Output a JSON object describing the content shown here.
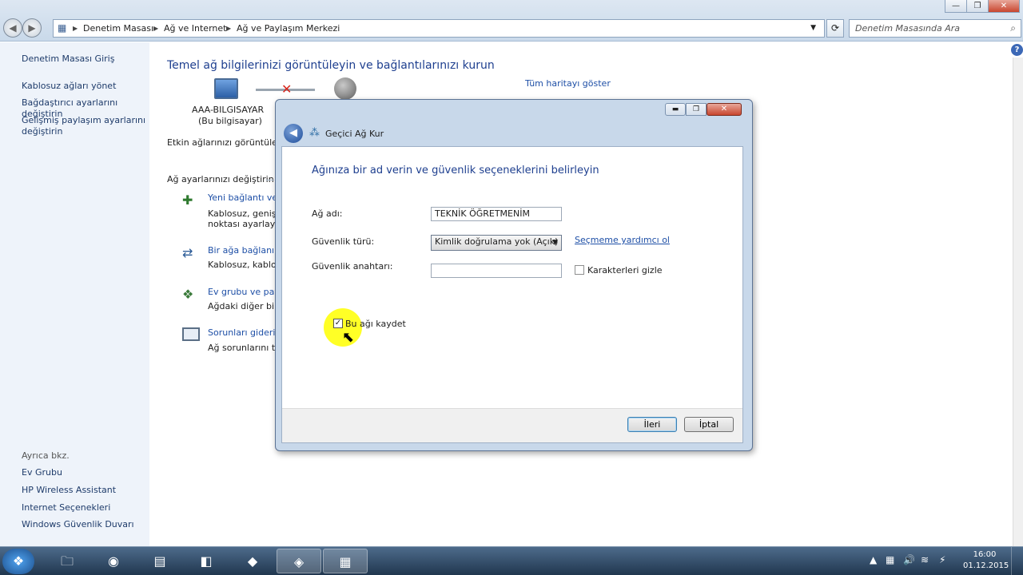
{
  "window_controls": {
    "minimize": "—",
    "maximize": "❐",
    "close": "✕"
  },
  "breadcrumb": [
    "Denetim Masası",
    "Ağ ve Internet",
    "Ağ ve Paylaşım Merkezi"
  ],
  "search": {
    "placeholder": "Denetim Masasında Ara"
  },
  "sidebar": {
    "home": "Denetim Masası Giriş",
    "items": [
      "Kablosuz ağları yönet",
      "Bağdaştırıcı ayarlarını değiştirin",
      "Gelişmiş paylaşım ayarlarını",
      "değiştirin"
    ],
    "see_also_title": "Ayrıca bkz.",
    "see_also": [
      "Ev Grubu",
      "HP Wireless Assistant",
      "Internet Seçenekleri",
      "Windows Güvenlik Duvarı"
    ]
  },
  "main": {
    "title": "Temel ağ bilgilerinizi görüntüleyin ve bağlantılarınızı kurun",
    "computer_name": "AAA-BILGISAYAR",
    "computer_sub": "(Bu bilgisayar)",
    "map_link": "Tüm haritayı göster",
    "active_networks": "Etkin ağlarınızı görüntüleyin",
    "change_settings": "Ağ ayarlarınızı değiştirin",
    "tasks": [
      {
        "title": "Yeni bağlantı vey",
        "desc1": "Kablosuz, geniş b",
        "desc2": "noktası ayarlayın"
      },
      {
        "title": "Bir ağa bağlanın",
        "desc1": "Kablosuz, kablolu",
        "desc2": ""
      },
      {
        "title": "Ev grubu ve payla",
        "desc1": "Ağdaki diğer bilgi",
        "desc2": ""
      },
      {
        "title": "Sorunları giderin",
        "desc1": "Ağ sorunlarını tan",
        "desc2": ""
      }
    ]
  },
  "dialog": {
    "title": "Geçici Ağ Kur",
    "heading": "Ağınıza bir ad verin ve güvenlik seçeneklerini belirleyin",
    "network_name_label": "Ağ adı:",
    "network_name_value": "TEKNİK ÖĞRETMENİM",
    "security_type_label": "Güvenlik türü:",
    "security_type_value": "Kimlik doğrulama yok (Açık)",
    "help_link": "Seçmeme yardımcı ol",
    "security_key_label": "Güvenlik anahtarı:",
    "security_key_value": "",
    "hide_chars_label": "Karakterleri gizle",
    "save_network_label": "Bu ağı kaydet",
    "save_network_checked": true,
    "next_button": "İleri",
    "cancel_button": "İptal"
  },
  "taskbar": {
    "time": "16:00",
    "date": "01.12.2015"
  },
  "colors": {
    "accent_link": "#1e3f8f",
    "highlight": "#ffff00"
  }
}
